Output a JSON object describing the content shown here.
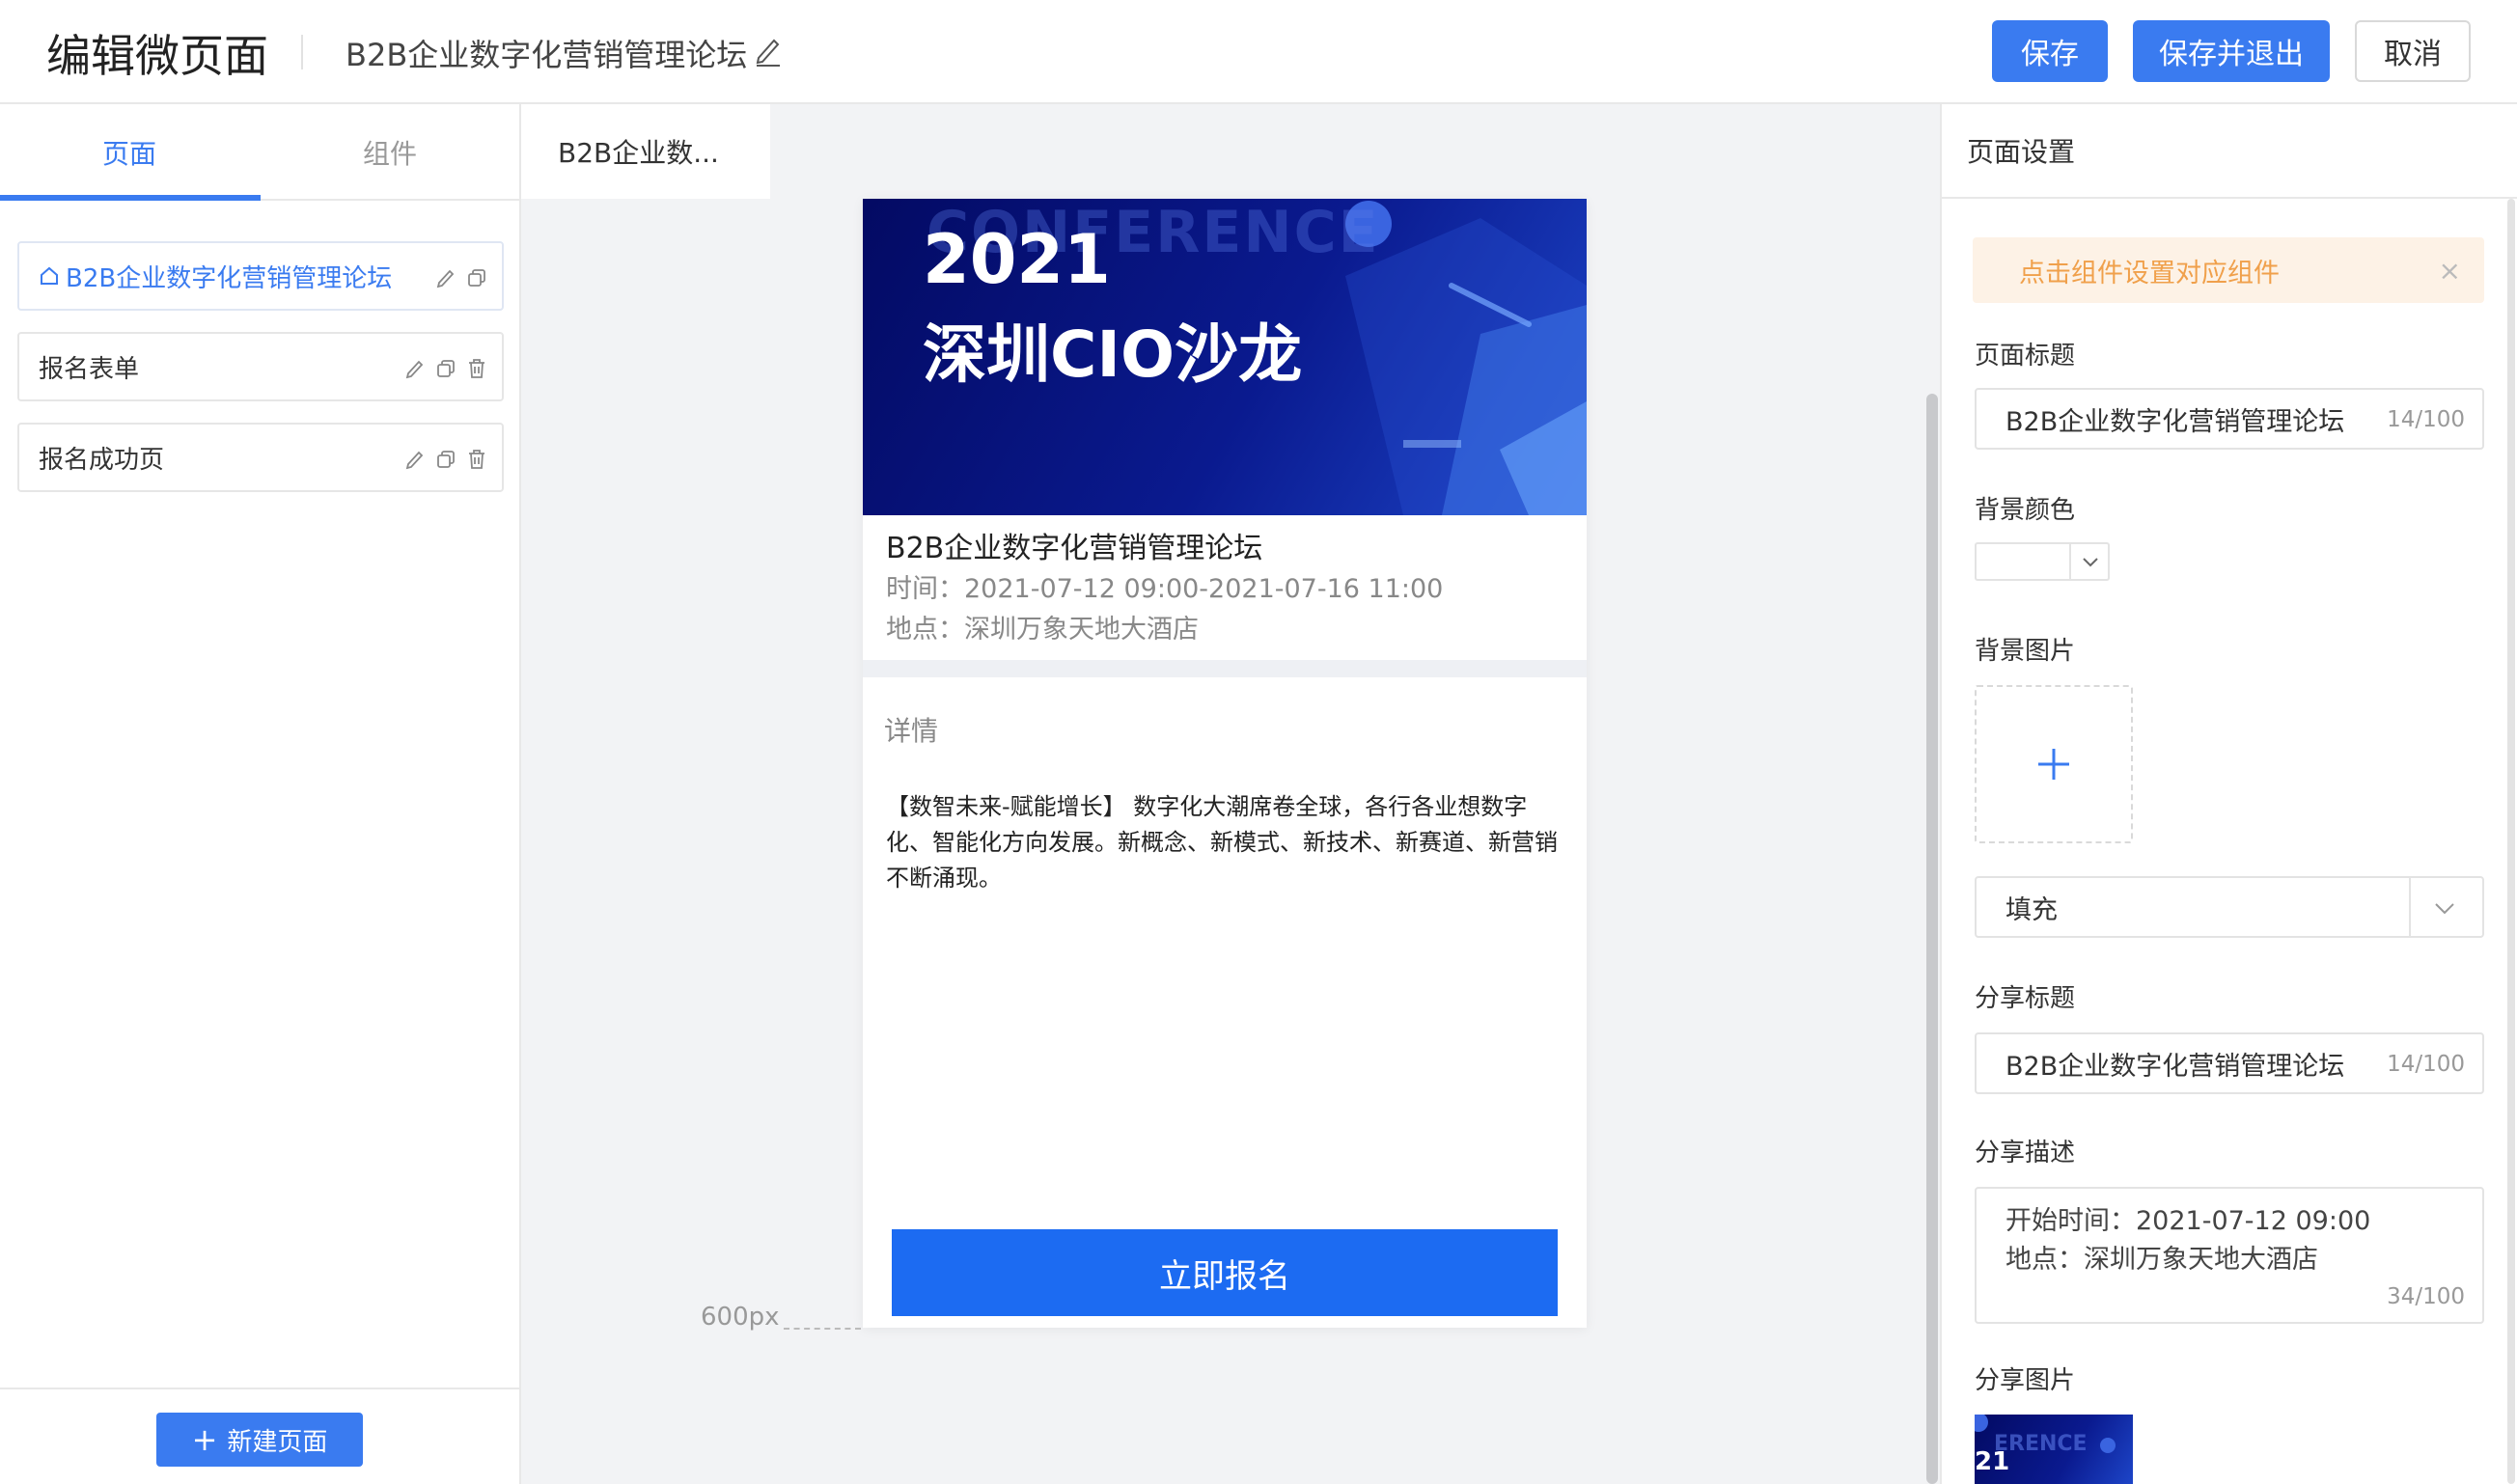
{
  "topbar": {
    "app_title": "编辑微页面",
    "doc_title": "B2B企业数字化营销管理论坛",
    "buttons": {
      "save": "保存",
      "save_exit": "保存并退出",
      "cancel": "取消"
    }
  },
  "left": {
    "tabs": [
      "页面",
      "组件"
    ],
    "pages": [
      {
        "label": "B2B企业数字化营销管理论坛",
        "home": true
      },
      {
        "label": "报名表单"
      },
      {
        "label": "报名成功页"
      }
    ],
    "new_page_label": "新建页面"
  },
  "center": {
    "tab_label": "B2B企业数...",
    "banner": {
      "ghost_text": "CONFERENCE",
      "year": "2021",
      "name": "深圳CIO沙龙"
    },
    "event": {
      "title": "B2B企业数字化营销管理论坛",
      "time": "时间：2021-07-12 09:00-2021-07-16 11:00",
      "place": "地点：深圳万象天地大酒店"
    },
    "detail_label": "详情",
    "detail_text": "【数智未来-赋能增长】 数字化大潮席卷全球，各行各业想数字化、智能化方向发展。新概念、新模式、新技术、新赛道、新营销不断涌现。",
    "signup_label": "立即报名",
    "px_label": "600px"
  },
  "right": {
    "header": "页面设置",
    "notice": "点击组件设置对应组件",
    "page_title_label": "页面标题",
    "page_title_value": "B2B企业数字化营销管理论坛",
    "page_title_count": "14/100",
    "bg_color_label": "背景颜色",
    "bg_image_label": "背景图片",
    "fill_option": "填充",
    "share_title_label": "分享标题",
    "share_title_value": "B2B企业数字化营销管理论坛",
    "share_title_count": "14/100",
    "share_desc_label": "分享描述",
    "share_desc_line1": "开始时间：2021-07-12 09:00",
    "share_desc_line2": "地点：深圳万象天地大酒店",
    "share_desc_count": "34/100",
    "share_image_label": "分享图片",
    "share_thumb_ghost": "ERENCE",
    "share_thumb_year": "21"
  },
  "colors": {
    "primary": "#3a7bf0",
    "signup": "#1c6bf2",
    "notice_bg": "#fdf2e6",
    "notice_text": "#f0a04b",
    "banner_dark": "#030a63"
  }
}
